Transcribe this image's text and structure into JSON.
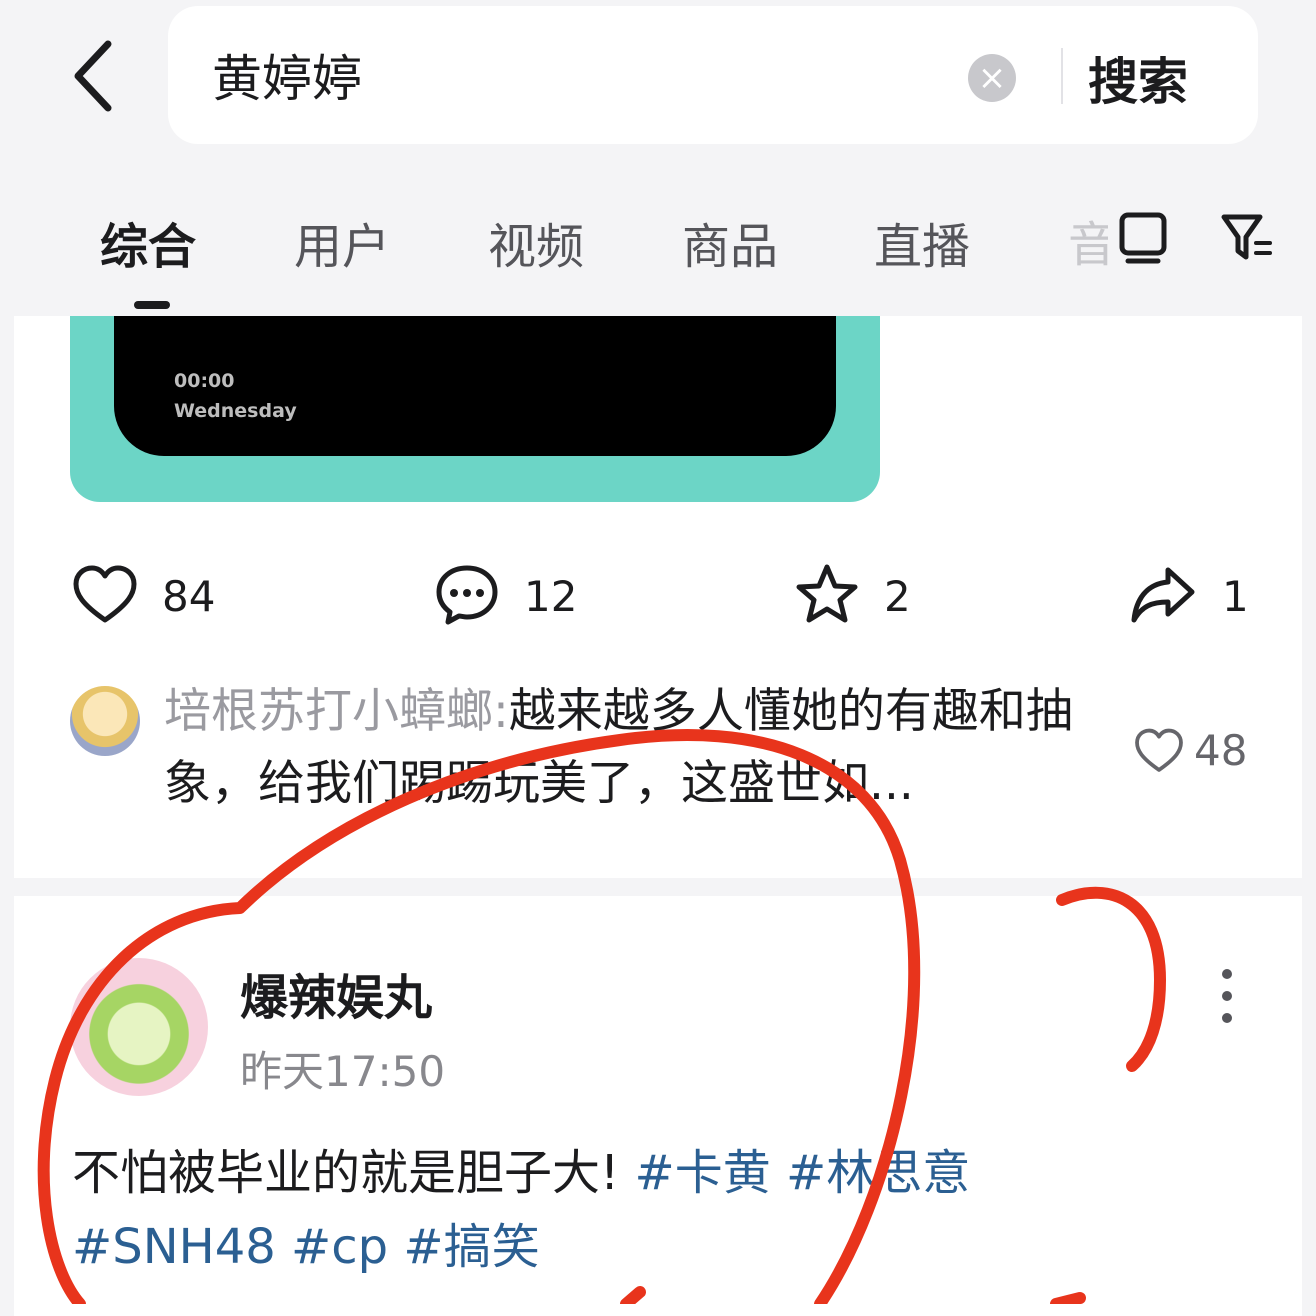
{
  "search": {
    "back_icon": "chevron-left-icon",
    "query": "黄婷婷",
    "clear_icon": "clear-circle-icon",
    "button_label": "搜索"
  },
  "tabs": {
    "items": [
      {
        "label": "综合",
        "active": true
      },
      {
        "label": "用户",
        "active": false
      },
      {
        "label": "视频",
        "active": false
      },
      {
        "label": "商品",
        "active": false
      },
      {
        "label": "直播",
        "active": false
      }
    ],
    "partial_label": "音",
    "icons": [
      "tv-icon",
      "filter-icon"
    ]
  },
  "post1": {
    "media": {
      "time": "00:00",
      "day": "Wednesday"
    },
    "actions": {
      "likes": "84",
      "comments": "12",
      "favorites": "2",
      "shares": "1"
    },
    "top_comment": {
      "user": "培根苏打小蟑螂:",
      "text": "越来越多人懂她的有趣和抽象，给我们踢踢玩美了，这盛世如...",
      "likes": "48"
    }
  },
  "post2": {
    "author": "爆辣娱丸",
    "time": "昨天17:50",
    "text": "不怕被毕业的就是胆子大! ",
    "hashtags": [
      "#卡黄",
      "#林思意",
      "#SNH48",
      "#cp",
      "#搞笑"
    ]
  },
  "colors": {
    "hashtag": "#2b5f92",
    "annotation": "#e8341c",
    "media_frame": "#6cd5c6"
  }
}
